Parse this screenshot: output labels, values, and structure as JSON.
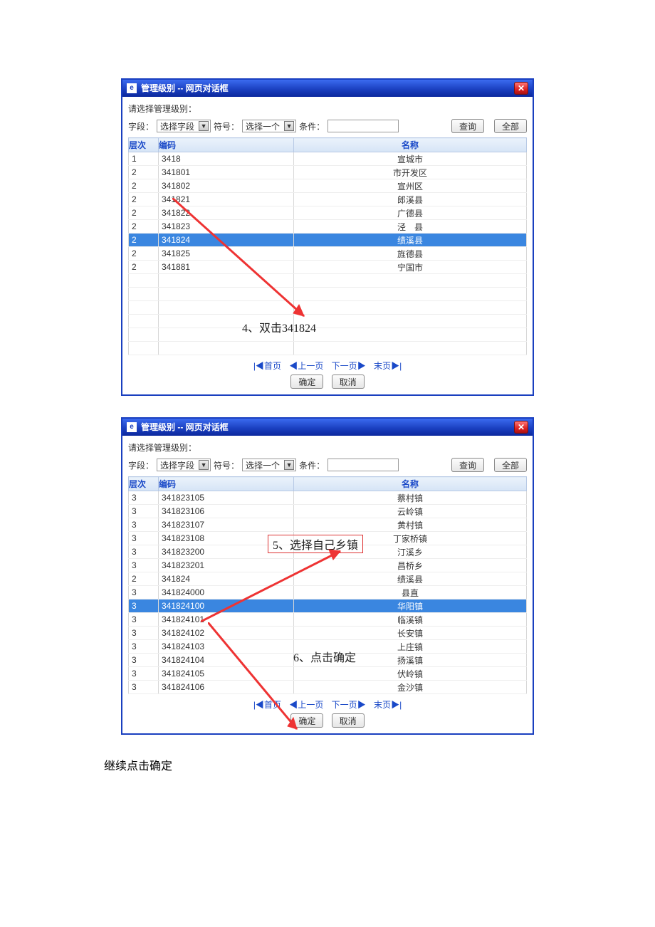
{
  "dialog1": {
    "title": "管理级别  --  网页对话框",
    "prompt": "请选择管理级别：",
    "filter": {
      "field_label": "字段：",
      "field_value": "选择字段",
      "op_label": "符号：",
      "op_value": "选择一个",
      "cond_label": "条件：",
      "cond_value": "",
      "search_btn": "查询",
      "all_btn": "全部"
    },
    "columns": {
      "level": "层次",
      "code": "编码",
      "name": "名称"
    },
    "rows": [
      {
        "level": "1",
        "code": "3418",
        "name": "宣城市",
        "selected": false
      },
      {
        "level": "2",
        "code": "341801",
        "name": "市开发区",
        "selected": false
      },
      {
        "level": "2",
        "code": "341802",
        "name": "宣州区",
        "selected": false
      },
      {
        "level": "2",
        "code": "341821",
        "name": "郎溪县",
        "selected": false
      },
      {
        "level": "2",
        "code": "341822",
        "name": "广德县",
        "selected": false
      },
      {
        "level": "2",
        "code": "341823",
        "name": "泾　县",
        "selected": false
      },
      {
        "level": "2",
        "code": "341824",
        "name": "绩溪县",
        "selected": true
      },
      {
        "level": "2",
        "code": "341825",
        "name": "旌德县",
        "selected": false
      },
      {
        "level": "2",
        "code": "341881",
        "name": "宁国市",
        "selected": false
      },
      {
        "level": "",
        "code": "",
        "name": "",
        "selected": false
      },
      {
        "level": "",
        "code": "",
        "name": "",
        "selected": false
      },
      {
        "level": "",
        "code": "",
        "name": "",
        "selected": false
      },
      {
        "level": "",
        "code": "",
        "name": "",
        "selected": false
      },
      {
        "level": "",
        "code": "",
        "name": "",
        "selected": false
      },
      {
        "level": "",
        "code": "",
        "name": "",
        "selected": false
      }
    ],
    "pager": {
      "first": "首页",
      "prev": "上一页",
      "next": "下一页",
      "last": "末页"
    },
    "ok_btn": "确定",
    "cancel_btn": "取消",
    "annotation4": "4、双击341824"
  },
  "dialog2": {
    "title": "管理级别  --  网页对话框",
    "prompt": "请选择管理级别：",
    "filter": {
      "field_label": "字段：",
      "field_value": "选择字段",
      "op_label": "符号：",
      "op_value": "选择一个",
      "cond_label": "条件：",
      "cond_value": "",
      "search_btn": "查询",
      "all_btn": "全部"
    },
    "columns": {
      "level": "层次",
      "code": "编码",
      "name": "名称"
    },
    "rows": [
      {
        "level": "3",
        "code": "341823105",
        "name": "蔡村镇",
        "selected": false
      },
      {
        "level": "3",
        "code": "341823106",
        "name": "云岭镇",
        "selected": false
      },
      {
        "level": "3",
        "code": "341823107",
        "name": "黄村镇",
        "selected": false
      },
      {
        "level": "3",
        "code": "341823108",
        "name": "丁家桥镇",
        "selected": false
      },
      {
        "level": "3",
        "code": "341823200",
        "name": "汀溪乡",
        "selected": false
      },
      {
        "level": "3",
        "code": "341823201",
        "name": "昌桥乡",
        "selected": false
      },
      {
        "level": "2",
        "code": "341824",
        "name": "绩溪县",
        "selected": false
      },
      {
        "level": "3",
        "code": "341824000",
        "name": "县直",
        "selected": false
      },
      {
        "level": "3",
        "code": "341824100",
        "name": "华阳镇",
        "selected": true
      },
      {
        "level": "3",
        "code": "341824101",
        "name": "临溪镇",
        "selected": false
      },
      {
        "level": "3",
        "code": "341824102",
        "name": "长安镇",
        "selected": false
      },
      {
        "level": "3",
        "code": "341824103",
        "name": "上庄镇",
        "selected": false
      },
      {
        "level": "3",
        "code": "341824104",
        "name": "扬溪镇",
        "selected": false
      },
      {
        "level": "3",
        "code": "341824105",
        "name": "伏岭镇",
        "selected": false
      },
      {
        "level": "3",
        "code": "341824106",
        "name": "金沙镇",
        "selected": false
      }
    ],
    "pager": {
      "first": "首页",
      "prev": "上一页",
      "next": "下一页",
      "last": "末页"
    },
    "ok_btn": "确定",
    "cancel_btn": "取消",
    "annotation5": "5、选择自己乡镇",
    "annotation6": "6、点击确定"
  },
  "footer_text": "继续点击确定"
}
